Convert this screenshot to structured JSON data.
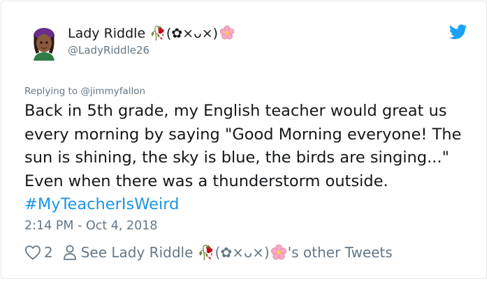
{
  "tweet": {
    "author_name": "Lady Riddle 🥀(✿×ᴗ×)",
    "handle": "@LadyRiddle26",
    "replying_prefix": "Replying to ",
    "replying_to": "@jimmyfallon",
    "text_body": "Back in 5th grade, my English teacher would great us every morning by saying \"Good Morning everyone! The sun is shining, the sky is blue, the birds are singing...\" Even when there was a thunderstorm outside. ",
    "hashtag": "#MyTeacherIsWeird",
    "timestamp": "2:14 PM - Oct 4, 2018"
  },
  "footer": {
    "likes_count": "2",
    "see_prefix": "See Lady Riddle 🥀(✿×ᴗ×)",
    "see_suffix": "'s other Tweets"
  },
  "icons": {
    "avatar": "avatar-image",
    "verified_brand": "twitter-bird-icon",
    "like": "heart-icon",
    "profile": "person-icon",
    "name_emoji": "flower-icon"
  },
  "colors": {
    "brand": "#1da1f2",
    "hashtag": "#1b95e0",
    "muted": "#657786",
    "text": "#14171a",
    "flower": "#f7a9c3"
  }
}
